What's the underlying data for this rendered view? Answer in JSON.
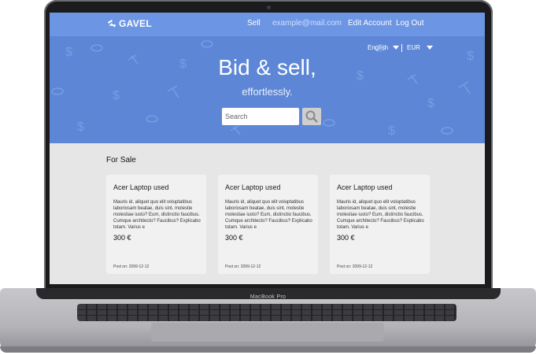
{
  "device": {
    "label": "MacBook Pro"
  },
  "brand": {
    "name": "GAVEL"
  },
  "nav": {
    "sell": "Sell",
    "email": "example@mail.com",
    "edit_account": "Edit Account",
    "logout": "Log Out"
  },
  "locale": {
    "language": "English",
    "currency": "EUR"
  },
  "hero": {
    "title": "Bid & sell,",
    "subtitle": "effortlessly."
  },
  "search": {
    "placeholder": "Search"
  },
  "section": {
    "title": "For Sale"
  },
  "cards": [
    {
      "title": "Acer Laptop used",
      "description": "Mauris id, aliquet quo elit voluptatibus laboriosam beatae, duis sint, molestie molestiae iusto? Eum, distinctio faucibus. Cumque architecto? Faucibus? Explicabo totam. Varius e",
      "price": "300 €",
      "posted": "Post on: 2099-12-12"
    },
    {
      "title": "Acer Laptop used",
      "description": "Mauris id, aliquet quo elit voluptatibus laboriosam beatae, duis sint, molestie molestiae iusto? Eum, distinctio faucibus. Cumque architecto? Faucibus? Explicabo totam. Varius e",
      "price": "300 €",
      "posted": "Post on: 2099-12-12"
    },
    {
      "title": "Acer Laptop used",
      "description": "Mauris id, aliquet quo elit voluptatibus laboriosam beatae, duis sint, molestie molestiae iusto? Eum, distinctio faucibus. Cumque architecto? Faucibus? Explicabo totam. Varius e",
      "price": "300 €",
      "posted": "Post on: 2099-12-12"
    }
  ],
  "colors": {
    "hero": "#5d87d6",
    "topbar": "#6c95e4",
    "card": "#f1f1f1",
    "page": "#e6e6e6"
  }
}
